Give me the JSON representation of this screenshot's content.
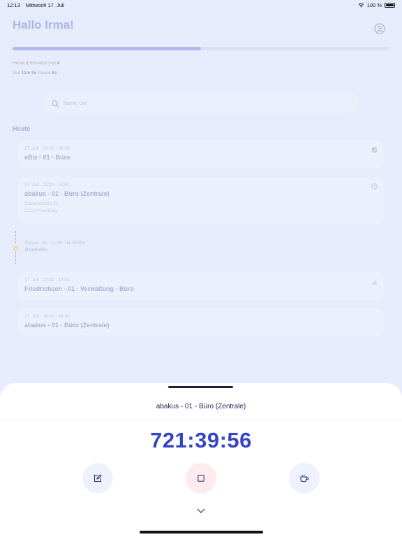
{
  "status_bar": {
    "time": "12:13",
    "date": "Mittwoch 17. Juli",
    "battery": "100 %"
  },
  "header": {
    "greeting": "Hallo Irma!",
    "progress_fraction": 0.5
  },
  "stats": {
    "line1": {
      "label1": "Heute",
      "value1": "2",
      "label2": "Einsätze von",
      "value2": "4"
    },
    "line2": {
      "label1": "Zeit",
      "value1": "11m 9s",
      "label2": "Pause",
      "value2": "8s"
    }
  },
  "search": {
    "placeholder": "Name, Ort"
  },
  "section_title": "Heute",
  "jobs": [
    {
      "meta": "17. Juli · 06:00 - 06:20",
      "title": "eBiz - 01 - Büro",
      "status": "done"
    },
    {
      "meta": "17. Juli · 11:00 - 13:00",
      "title": "abakus - 01 - Büro (Zentrale)",
      "address1": "Sabeerstraße 20",
      "address2": "21220 Hamburg",
      "status": "running"
    },
    {
      "meta": "17. Juli · 12:01 - 12:02",
      "title": "Friedrichsen - 01 - Verwaltung - Büro",
      "status": "planned"
    },
    {
      "meta": "17. Juli · 18:00 - 18:30",
      "title": "abakus - 01 - Büro (Zentrale)",
      "status": "planned"
    }
  ],
  "pause": {
    "text": "Pause · 8s · 11:46 - 11:46 Uhr",
    "link": "Bearbeiten"
  },
  "sheet": {
    "title": "abakus - 01 - Büro (Zentrale)",
    "timer": "721:39:56"
  },
  "colors": {
    "accent": "#3546c2",
    "stop_bg": "#fdecee",
    "button_bg": "#eef2fc"
  },
  "icons": [
    "wifi-icon",
    "battery-icon",
    "profile-icon",
    "search-icon",
    "check-icon",
    "clock-icon",
    "coffee-icon",
    "edit-icon",
    "stop-icon",
    "chevron-down-icon"
  ]
}
